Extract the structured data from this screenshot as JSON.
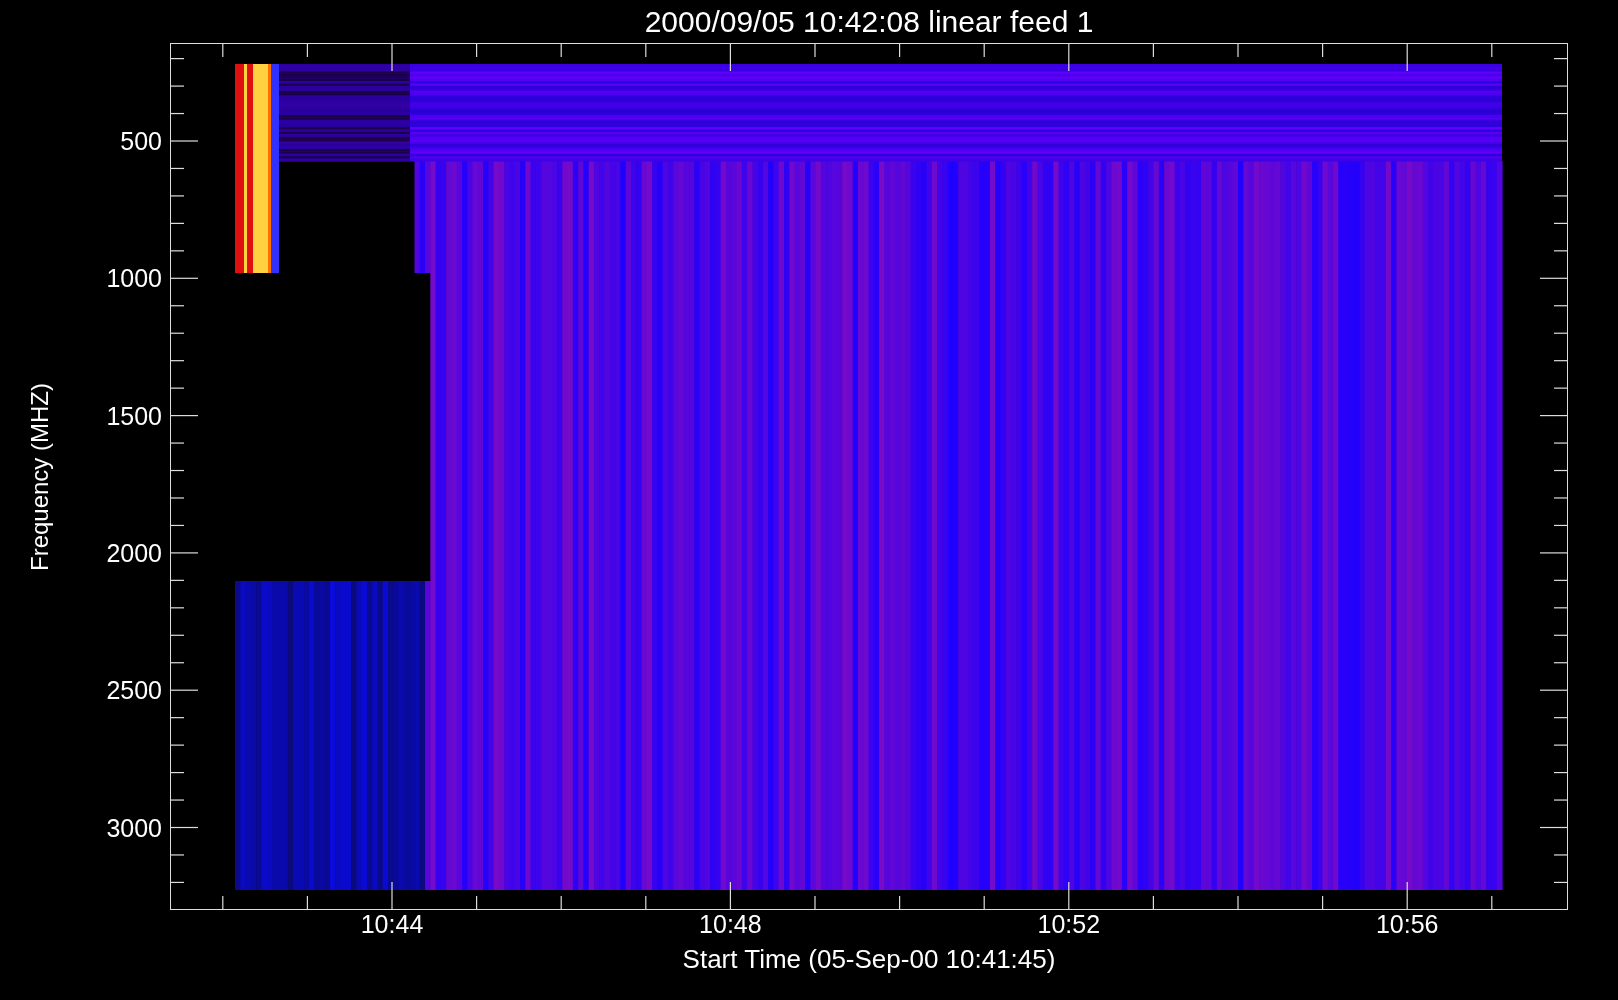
{
  "title": "2000/09/05 10:42:08 linear feed 1",
  "y_axis": {
    "label": "Frequency (MHZ)",
    "ticks": [
      "500",
      "1000",
      "1500",
      "2000",
      "2500",
      "3000"
    ]
  },
  "x_axis": {
    "label": "Start Time (05-Sep-00 10:41:45)",
    "ticks": [
      "10:44",
      "10:48",
      "10:52",
      "10:56"
    ]
  }
}
